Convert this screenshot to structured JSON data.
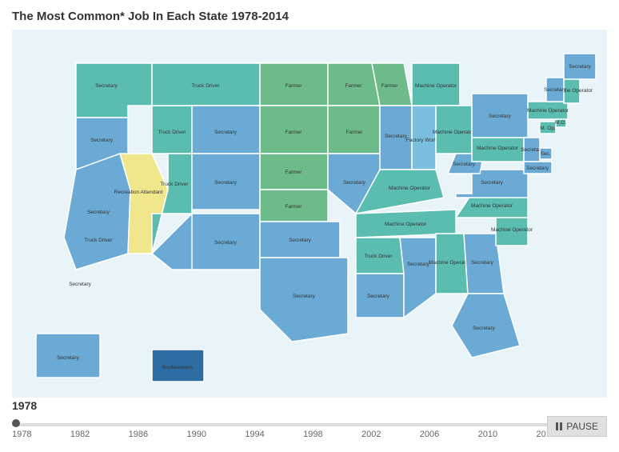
{
  "title": "The Most Common* Job In Each State 1978-2014",
  "current_year": "1978",
  "timeline": {
    "years": [
      "1978",
      "1982",
      "1986",
      "1990",
      "1994",
      "1998",
      "2002",
      "2006",
      "2010",
      "2014"
    ],
    "pause_label": "PAUSE"
  },
  "colors": {
    "teal": "#5bbcb0",
    "green": "#6dbb8a",
    "blue": "#6aaad4",
    "light_blue": "#7bbfe0",
    "yellow": "#f0e68c",
    "dark_blue": "#2e6da4",
    "mid_blue": "#4a90c4"
  },
  "states": [
    {
      "id": "WA",
      "label": "Secretary",
      "color": "teal"
    },
    {
      "id": "OR",
      "label": "Secretary",
      "color": "blue"
    },
    {
      "id": "CA",
      "label": "Secretary",
      "color": "blue"
    },
    {
      "id": "NV",
      "label": "Recreation Attendant",
      "color": "yellow"
    },
    {
      "id": "ID",
      "label": "Truck Driver",
      "color": "teal"
    },
    {
      "id": "MT",
      "label": "Truck Driver",
      "color": "teal"
    },
    {
      "id": "WY",
      "label": "Secretary",
      "color": "blue"
    },
    {
      "id": "UT",
      "label": "Truck Driver",
      "color": "teal"
    },
    {
      "id": "CO",
      "label": "Secretary",
      "color": "blue"
    },
    {
      "id": "AZ",
      "label": "Secretary",
      "color": "blue"
    },
    {
      "id": "NM",
      "label": "Secretary",
      "color": "blue"
    },
    {
      "id": "ND",
      "label": "Farmer",
      "color": "green"
    },
    {
      "id": "SD",
      "label": "Farmer",
      "color": "green"
    },
    {
      "id": "NE",
      "label": "Farmer",
      "color": "green"
    },
    {
      "id": "KS",
      "label": "Farmer",
      "color": "green"
    },
    {
      "id": "MN",
      "label": "Farmer",
      "color": "green"
    },
    {
      "id": "IA",
      "label": "Farmer",
      "color": "green"
    },
    {
      "id": "MO",
      "label": "Secretary",
      "color": "blue"
    },
    {
      "id": "WI",
      "label": "Farmer",
      "color": "green"
    },
    {
      "id": "IL",
      "label": "Secretary",
      "color": "blue"
    },
    {
      "id": "MI",
      "label": "Machine Operator",
      "color": "teal"
    },
    {
      "id": "IN",
      "label": "Factory Worker",
      "color": "blue"
    },
    {
      "id": "OH",
      "label": "Machine Operator",
      "color": "teal"
    },
    {
      "id": "KY",
      "label": "Machine Operator",
      "color": "teal"
    },
    {
      "id": "TN",
      "label": "Machine Operator",
      "color": "teal"
    },
    {
      "id": "AR",
      "label": "Truck Driver",
      "color": "teal"
    },
    {
      "id": "LA",
      "label": "Secretary",
      "color": "blue"
    },
    {
      "id": "MS",
      "label": "Secretary",
      "color": "blue"
    },
    {
      "id": "AL",
      "label": "Machine Operator",
      "color": "teal"
    },
    {
      "id": "GA",
      "label": "Secretary",
      "color": "blue"
    },
    {
      "id": "FL",
      "label": "Secretary",
      "color": "blue"
    },
    {
      "id": "SC",
      "label": "Machine Operator",
      "color": "teal"
    },
    {
      "id": "NC",
      "label": "Machine Operator",
      "color": "teal"
    },
    {
      "id": "VA",
      "label": "Secretary",
      "color": "blue"
    },
    {
      "id": "WV",
      "label": "Secretary",
      "color": "blue"
    },
    {
      "id": "PA",
      "label": "Machine Operator",
      "color": "teal"
    },
    {
      "id": "NY",
      "label": "Secretary",
      "color": "blue"
    },
    {
      "id": "VT",
      "label": "Secretary",
      "color": "blue"
    },
    {
      "id": "NH",
      "label": "Machine Operator",
      "color": "teal"
    },
    {
      "id": "ME",
      "label": "Secretary",
      "color": "blue"
    },
    {
      "id": "MA",
      "label": "Machine Operator",
      "color": "teal"
    },
    {
      "id": "RI",
      "label": "Machine Operator",
      "color": "teal"
    },
    {
      "id": "CT",
      "label": "Machine Operator",
      "color": "teal"
    },
    {
      "id": "NJ",
      "label": "Secretary",
      "color": "blue"
    },
    {
      "id": "DE",
      "label": "Secretary",
      "color": "blue"
    },
    {
      "id": "MD",
      "label": "Secretary",
      "color": "blue"
    },
    {
      "id": "OK",
      "label": "Secretary",
      "color": "blue"
    },
    {
      "id": "TX",
      "label": "Secretary",
      "color": "blue"
    },
    {
      "id": "AK",
      "label": "Secretary",
      "color": "blue"
    },
    {
      "id": "HI",
      "label": "Bookkeepers",
      "color": "dark_blue"
    },
    {
      "id": "Farmer_IA_MO",
      "label": "Farmer",
      "color": "green"
    },
    {
      "id": "Truck_Driver_NE",
      "label": "Truck Driver",
      "color": "teal"
    },
    {
      "id": "Secretary_KS",
      "label": "Secretary",
      "color": "blue"
    }
  ]
}
